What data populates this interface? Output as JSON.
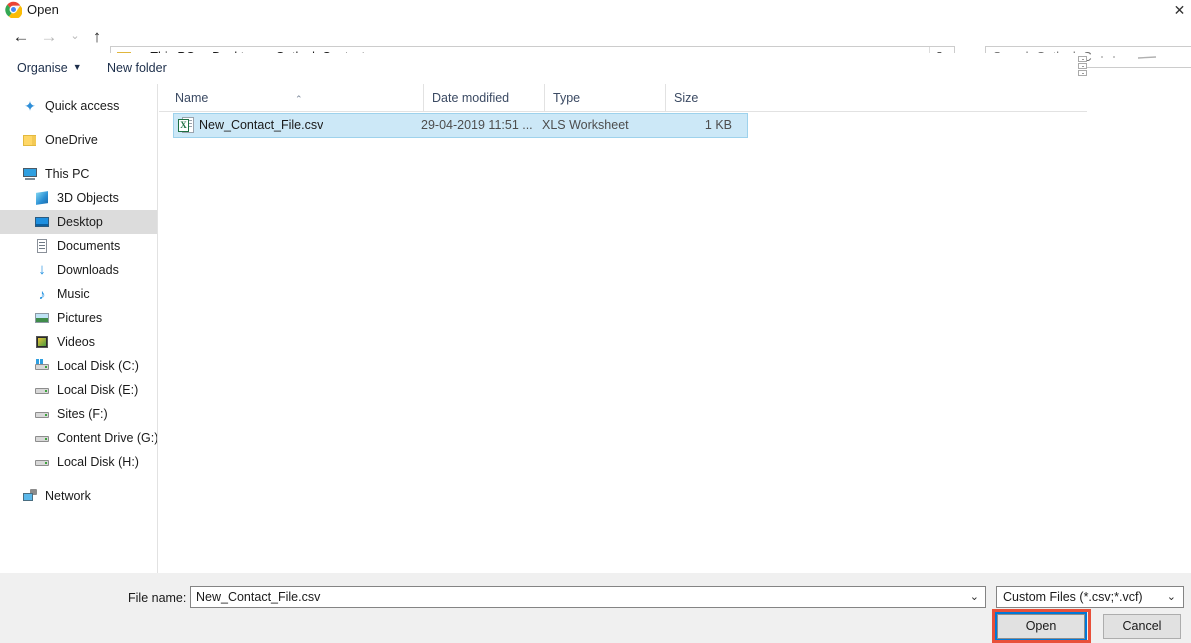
{
  "window": {
    "title": "Open",
    "app_icon": "chrome-icon",
    "close_label": "✕"
  },
  "nav": {
    "back": "←",
    "forward": "→",
    "history": "⌄",
    "up": "↑",
    "breadcrumbs": [
      "This PC",
      "Desktop",
      "Outlook Contacts"
    ],
    "separator": "›",
    "dropdown": "⌄",
    "refresh": "↻"
  },
  "search": {
    "placeholder": "Search Outlook C"
  },
  "toolbar": {
    "organise_label": "Organise",
    "organise_caret": "▼",
    "new_folder_label": "New folder",
    "view_options": "view-options-icon"
  },
  "sidebar": {
    "items": [
      {
        "label": "Quick access",
        "icon": "star-icon",
        "level": 0,
        "selected": false,
        "gap_after": true
      },
      {
        "label": "OneDrive",
        "icon": "folder-icon",
        "level": 0,
        "selected": false,
        "gap_after": true
      },
      {
        "label": "This PC",
        "icon": "computer-icon",
        "level": 0,
        "selected": false,
        "gap_after": false
      },
      {
        "label": "3D Objects",
        "icon": "3d-objects-icon",
        "level": 1,
        "selected": false,
        "gap_after": false
      },
      {
        "label": "Desktop",
        "icon": "desktop-icon",
        "level": 1,
        "selected": true,
        "gap_after": false
      },
      {
        "label": "Documents",
        "icon": "documents-icon",
        "level": 1,
        "selected": false,
        "gap_after": false
      },
      {
        "label": "Downloads",
        "icon": "downloads-icon",
        "level": 1,
        "selected": false,
        "gap_after": false
      },
      {
        "label": "Music",
        "icon": "music-icon",
        "level": 1,
        "selected": false,
        "gap_after": false
      },
      {
        "label": "Pictures",
        "icon": "pictures-icon",
        "level": 1,
        "selected": false,
        "gap_after": false
      },
      {
        "label": "Videos",
        "icon": "videos-icon",
        "level": 1,
        "selected": false,
        "gap_after": false
      },
      {
        "label": "Local Disk (C:)",
        "icon": "system-drive-icon",
        "level": 1,
        "selected": false,
        "gap_after": false
      },
      {
        "label": "Local Disk (E:)",
        "icon": "drive-icon",
        "level": 1,
        "selected": false,
        "gap_after": false
      },
      {
        "label": "Sites (F:)",
        "icon": "drive-icon",
        "level": 1,
        "selected": false,
        "gap_after": false
      },
      {
        "label": "Content Drive (G:)",
        "icon": "drive-icon",
        "level": 1,
        "selected": false,
        "gap_after": false
      },
      {
        "label": "Local Disk (H:)",
        "icon": "drive-icon",
        "level": 1,
        "selected": false,
        "gap_after": true
      },
      {
        "label": "Network",
        "icon": "network-icon",
        "level": 0,
        "selected": false,
        "gap_after": false
      }
    ]
  },
  "filelist": {
    "columns": [
      {
        "label": "Name",
        "sorted": "asc"
      },
      {
        "label": "Date modified",
        "sorted": ""
      },
      {
        "label": "Type",
        "sorted": ""
      },
      {
        "label": "Size",
        "sorted": ""
      }
    ],
    "sort_caret": "⌃",
    "rows": [
      {
        "name": "New_Contact_File.csv",
        "date_modified": "29-04-2019 11:51 ...",
        "type": "XLS Worksheet",
        "size": "1 KB",
        "icon": "xls-file-icon",
        "icon_badge": "X",
        "selected": true
      }
    ]
  },
  "footer": {
    "file_name_label": "File name:",
    "file_name_value": "New_Contact_File.csv",
    "file_name_placeholder": "File name",
    "file_name_caret": "⌄",
    "filter_value": "Custom Files (*.csv;*.vcf)",
    "filter_caret": "⌄",
    "open_label": "Open",
    "cancel_label": "Cancel"
  },
  "colors": {
    "accent_focus": "#0078D7",
    "annotation_red": "#E8503A",
    "selection_fill": "#CCE8F7",
    "selection_border": "#9ED2EC",
    "chrome_bg": "#F0F0F0"
  }
}
